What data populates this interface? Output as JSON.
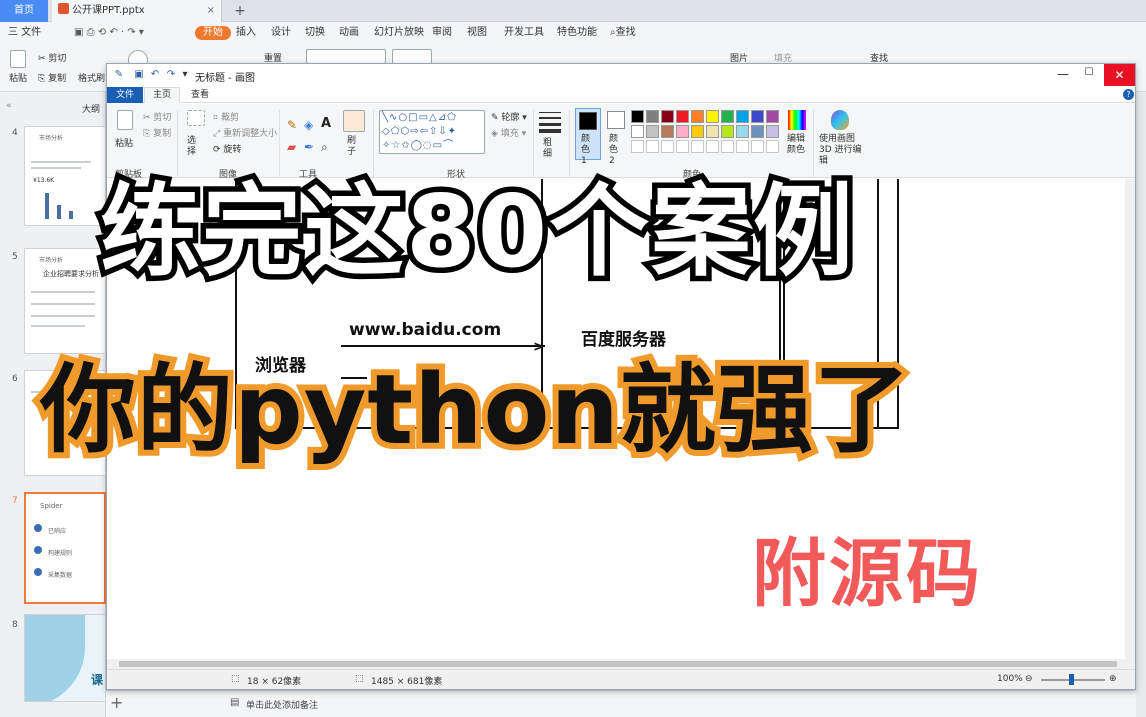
{
  "wps": {
    "tabs": {
      "home": "首页",
      "doc": "公开课PPT.pptx",
      "add": "+"
    },
    "menus": [
      "开始",
      "插入",
      "设计",
      "切换",
      "动画",
      "幻灯片放映",
      "审阅",
      "视图",
      "开发工具",
      "特色功能"
    ],
    "file_menu": "三 文件",
    "search": "查找",
    "ribbon": {
      "paste": "粘贴",
      "cut": "剪切",
      "copy": "复制",
      "format_painter": "格式刷",
      "reset": "重置",
      "picture": "图片",
      "fill": "填充",
      "find": "查找"
    },
    "left_panel": {
      "outline_tab": "大纲",
      "slide_numbers": [
        "4",
        "5",
        "6",
        "7",
        "8"
      ]
    },
    "thumb4": {
      "title": "市场分析",
      "value": "¥13.6K"
    },
    "thumb5": {
      "title": "市场分析",
      "subtitle": "企业招聘要求分析"
    },
    "thumb7": {
      "title": "Spider",
      "items": [
        "已响应",
        "构建规则",
        "采集数据"
      ]
    },
    "thumb8": {
      "text": "课"
    },
    "status_note": "单击此处添加备注",
    "add_slide": "+"
  },
  "paint": {
    "title": "无标题 - 画图",
    "tabs": {
      "file": "文件",
      "home": "主页",
      "view": "查看"
    },
    "clipboard": {
      "paste": "粘贴",
      "cut": "剪切",
      "copy": "复制",
      "label": "剪贴板"
    },
    "image": {
      "select": "选择",
      "crop": "裁剪",
      "resize": "重新调整大小",
      "rotate": "旋转",
      "label": "图像"
    },
    "tools": {
      "label": "工具",
      "brush": "刷子"
    },
    "shapes": {
      "outline": "轮廓",
      "fill": "填充",
      "label": "形状"
    },
    "size": {
      "label": "粗细"
    },
    "colors": {
      "color1": "颜色 1",
      "color2": "颜色 2",
      "edit": "编辑颜色",
      "label": "颜色",
      "palette_row1": [
        "#000000",
        "#7f7f7f",
        "#880015",
        "#ed1c24",
        "#ff7f27",
        "#fff200",
        "#22b14c",
        "#00a2e8",
        "#3f48cc",
        "#a349a4"
      ],
      "palette_row2": [
        "#ffffff",
        "#c3c3c3",
        "#b97a57",
        "#ffaec9",
        "#ffc90e",
        "#efe4b0",
        "#b5e61d",
        "#99d9ea",
        "#7092be",
        "#c8bfe7"
      ]
    },
    "paint3d": "使用画图 3D 进行编辑",
    "status": {
      "selection": "18 × 62像素",
      "size": "1485 × 681像素",
      "zoom": "100%"
    },
    "canvas": {
      "url": "www.baidu.com",
      "browser": "浏览器",
      "server": "百度服务器"
    }
  },
  "overlay": {
    "line1": "练完这80个案例",
    "line2": "你的python就强了",
    "line3": "附源码"
  }
}
